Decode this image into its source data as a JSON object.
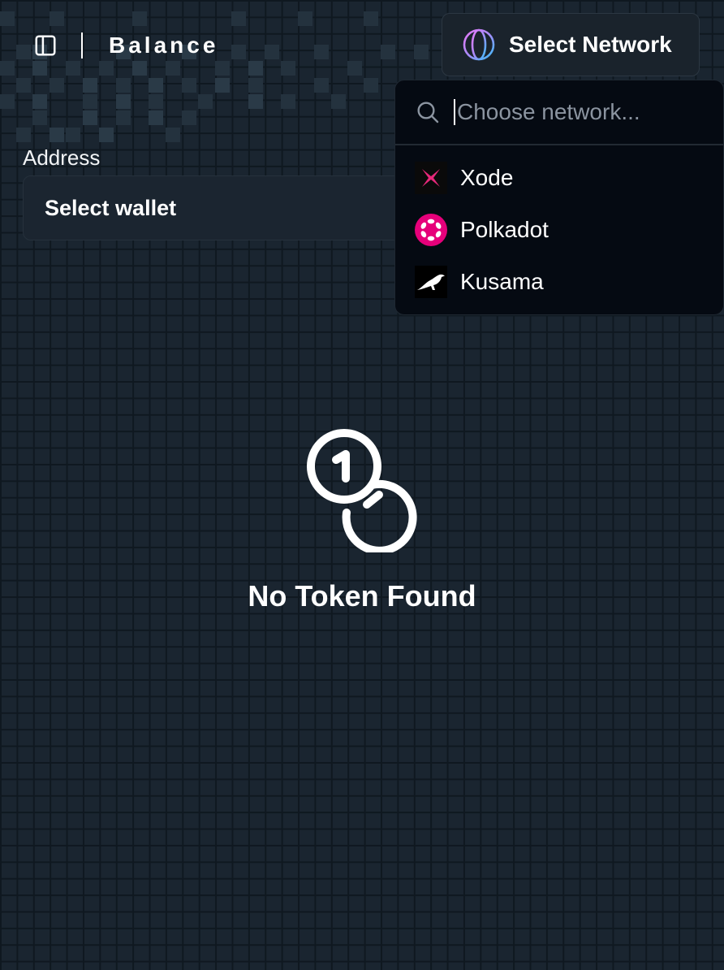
{
  "header": {
    "title": "Balance",
    "sidebar_toggle_icon": "sidebar-panel-icon",
    "network_button": {
      "label": "Select Network",
      "icon": "globe-icon"
    }
  },
  "address": {
    "label": "Address",
    "wallet_select_label": "Select wallet"
  },
  "network_dropdown": {
    "search": {
      "placeholder": "Choose network...",
      "value": "",
      "icon": "search-icon"
    },
    "items": [
      {
        "label": "Xode",
        "icon": "xode-logo-icon",
        "color": "#e6287a"
      },
      {
        "label": "Polkadot",
        "icon": "polkadot-logo-icon",
        "color": "#e6007a"
      },
      {
        "label": "Kusama",
        "icon": "kusama-logo-icon",
        "color": "#000000"
      }
    ]
  },
  "empty_state": {
    "icon": "coins-icon",
    "title": "No Token Found"
  },
  "colors": {
    "background": "#1a2530",
    "grid_line": "#0f1820",
    "dropdown_background": "#050a12",
    "text": "#ffffff",
    "placeholder": "#8b94a0"
  }
}
